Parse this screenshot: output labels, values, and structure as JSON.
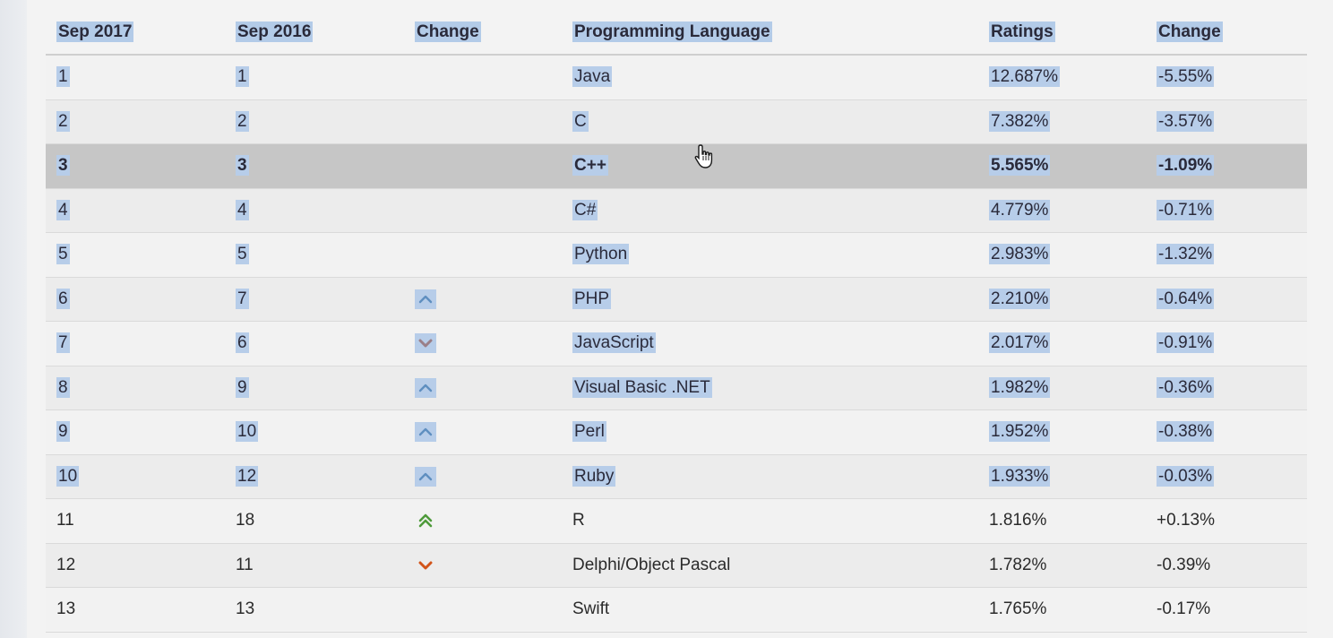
{
  "table": {
    "headers": [
      "Sep 2017",
      "Sep 2016",
      "Change",
      "Programming Language",
      "Ratings",
      "Change"
    ],
    "rows": [
      {
        "rank_2017": "1",
        "rank_2016": "1",
        "trend": "none",
        "language": "Java",
        "rating": "12.687%",
        "change": "-5.55%",
        "selected": true
      },
      {
        "rank_2017": "2",
        "rank_2016": "2",
        "trend": "none",
        "language": "C",
        "rating": "7.382%",
        "change": "-3.57%",
        "selected": true
      },
      {
        "rank_2017": "3",
        "rank_2016": "3",
        "trend": "none",
        "language": "C++",
        "rating": "5.565%",
        "change": "-1.09%",
        "selected": true,
        "hovered": true
      },
      {
        "rank_2017": "4",
        "rank_2016": "4",
        "trend": "none",
        "language": "C#",
        "rating": "4.779%",
        "change": "-0.71%",
        "selected": true
      },
      {
        "rank_2017": "5",
        "rank_2016": "5",
        "trend": "none",
        "language": "Python",
        "rating": "2.983%",
        "change": "-1.32%",
        "selected": true
      },
      {
        "rank_2017": "6",
        "rank_2016": "7",
        "trend": "up",
        "language": "PHP",
        "rating": "2.210%",
        "change": "-0.64%",
        "selected": true
      },
      {
        "rank_2017": "7",
        "rank_2016": "6",
        "trend": "down",
        "language": "JavaScript",
        "rating": "2.017%",
        "change": "-0.91%",
        "selected": true
      },
      {
        "rank_2017": "8",
        "rank_2016": "9",
        "trend": "up",
        "language": "Visual Basic .NET",
        "rating": "1.982%",
        "change": "-0.36%",
        "selected": true
      },
      {
        "rank_2017": "9",
        "rank_2016": "10",
        "trend": "up",
        "language": "Perl",
        "rating": "1.952%",
        "change": "-0.38%",
        "selected": true
      },
      {
        "rank_2017": "10",
        "rank_2016": "12",
        "trend": "up",
        "language": "Ruby",
        "rating": "1.933%",
        "change": "-0.03%",
        "selected": true
      },
      {
        "rank_2017": "11",
        "rank_2016": "18",
        "trend": "double-up",
        "language": "R",
        "rating": "1.816%",
        "change": "+0.13%",
        "selected": false
      },
      {
        "rank_2017": "12",
        "rank_2016": "11",
        "trend": "down",
        "language": "Delphi/Object Pascal",
        "rating": "1.782%",
        "change": "-0.39%",
        "selected": false
      },
      {
        "rank_2017": "13",
        "rank_2016": "13",
        "trend": "none",
        "language": "Swift",
        "rating": "1.765%",
        "change": "-0.17%",
        "selected": false
      }
    ]
  },
  "colors": {
    "selection": "#b7cde9",
    "hover_row": "#c6c6c6",
    "arrow_up_selected": "#5f8fc0",
    "arrow_down_selected": "#9a7f88",
    "arrow_double_up": "#4e9a3a",
    "arrow_down": "#d2541a"
  },
  "icons": {
    "up": "chevron-up-icon",
    "down": "chevron-down-icon",
    "double-up": "double-chevron-up-icon",
    "cursor": "hand-pointer-cursor-icon"
  }
}
